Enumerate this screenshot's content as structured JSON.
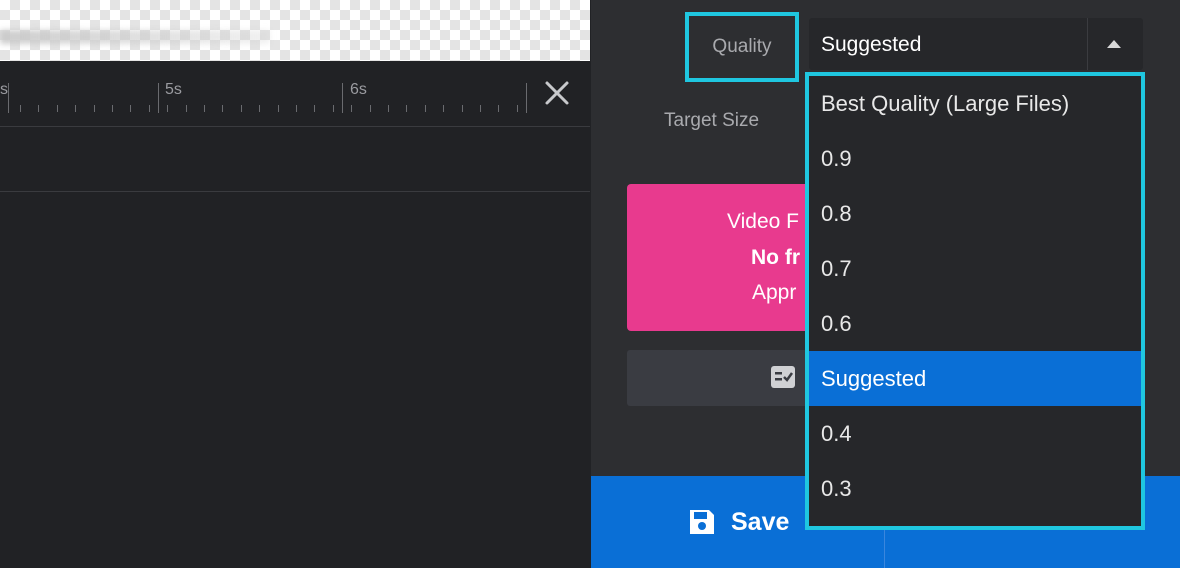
{
  "timeline": {
    "labels": [
      "s",
      "5s",
      "6s"
    ]
  },
  "panel": {
    "quality_label": "Quality",
    "quality_value": "Suggested",
    "target_size_label": "Target Size",
    "promo": {
      "line1": "Video F",
      "line2": "No fr",
      "line3": "Appr",
      "color": "#e83a8e"
    },
    "save_label": "Save",
    "save_peek": "..."
  },
  "dropdown": {
    "options": [
      "Best Quality (Large Files)",
      "0.9",
      "0.8",
      "0.7",
      "0.6",
      "Suggested",
      "0.4",
      "0.3"
    ],
    "selected": "Suggested",
    "highlight_color": "#1fc7e0",
    "selected_color": "#0a6fd6"
  }
}
